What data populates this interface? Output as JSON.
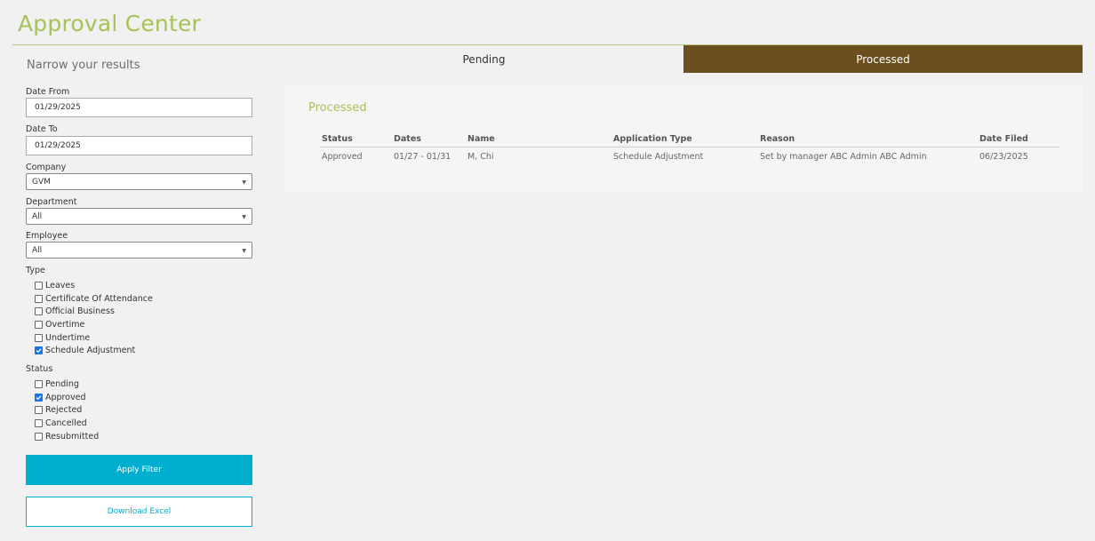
{
  "app": {
    "title": "Approval Center"
  },
  "tabs": [
    {
      "label": "Pending",
      "active": false
    },
    {
      "label": "Processed",
      "active": true
    }
  ],
  "colors": {
    "accent": "#a8c256",
    "active_tab": "#6b4f1f",
    "primary_button": "#00afd0",
    "checkbox": "#1a73e8"
  },
  "filters": {
    "heading": "Narrow your results",
    "date_from": {
      "label": "Date From",
      "value": "01/29/2025"
    },
    "date_to": {
      "label": "Date To",
      "value": "01/29/2025"
    },
    "company": {
      "label": "Company",
      "value": "GVM"
    },
    "department": {
      "label": "Department",
      "value": "All"
    },
    "employee": {
      "label": "Employee",
      "value": "All"
    },
    "type": {
      "label": "Type",
      "options": [
        {
          "label": "Leaves",
          "checked": false
        },
        {
          "label": "Certificate Of Attendance",
          "checked": false
        },
        {
          "label": "Official Business",
          "checked": false
        },
        {
          "label": "Overtime",
          "checked": false
        },
        {
          "label": "Undertime",
          "checked": false
        },
        {
          "label": "Schedule Adjustment",
          "checked": true
        }
      ]
    },
    "status": {
      "label": "Status",
      "options": [
        {
          "label": "Pending",
          "checked": false
        },
        {
          "label": "Approved",
          "checked": true
        },
        {
          "label": "Rejected",
          "checked": false
        },
        {
          "label": "Cancelled",
          "checked": false
        },
        {
          "label": "Resubmitted",
          "checked": false
        }
      ]
    },
    "apply_label": "Apply Filter",
    "download_label": "Download Excel"
  },
  "results": {
    "title": "Processed",
    "columns": [
      "Status",
      "Dates",
      "Name",
      "Application Type",
      "Reason",
      "Date Filed"
    ],
    "rows": [
      [
        "Approved",
        "01/27 - 01/31",
        "M, Chi",
        "Schedule Adjustment",
        "Set by manager ABC Admin ABC Admin",
        "06/23/2025"
      ]
    ]
  }
}
